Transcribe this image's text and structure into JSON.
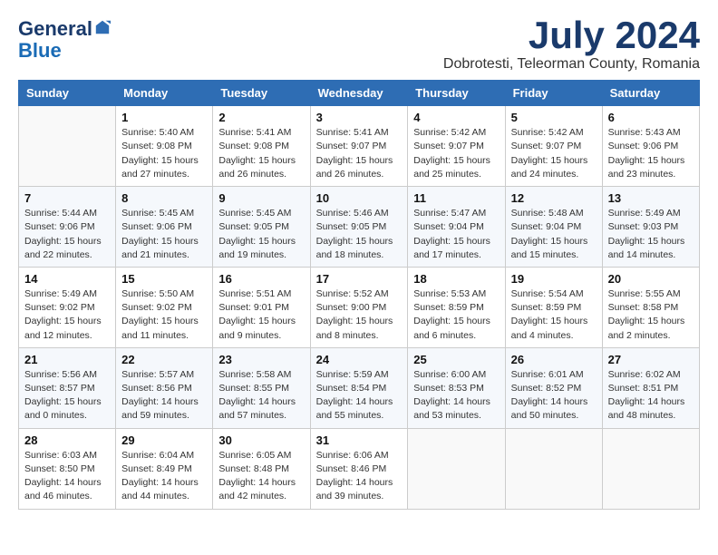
{
  "header": {
    "logo_general": "General",
    "logo_blue": "Blue",
    "main_title": "July 2024",
    "subtitle": "Dobrotesti, Teleorman County, Romania"
  },
  "calendar": {
    "days_of_week": [
      "Sunday",
      "Monday",
      "Tuesday",
      "Wednesday",
      "Thursday",
      "Friday",
      "Saturday"
    ],
    "weeks": [
      [
        {
          "day": "",
          "info": ""
        },
        {
          "day": "1",
          "info": "Sunrise: 5:40 AM\nSunset: 9:08 PM\nDaylight: 15 hours\nand 27 minutes."
        },
        {
          "day": "2",
          "info": "Sunrise: 5:41 AM\nSunset: 9:08 PM\nDaylight: 15 hours\nand 26 minutes."
        },
        {
          "day": "3",
          "info": "Sunrise: 5:41 AM\nSunset: 9:07 PM\nDaylight: 15 hours\nand 26 minutes."
        },
        {
          "day": "4",
          "info": "Sunrise: 5:42 AM\nSunset: 9:07 PM\nDaylight: 15 hours\nand 25 minutes."
        },
        {
          "day": "5",
          "info": "Sunrise: 5:42 AM\nSunset: 9:07 PM\nDaylight: 15 hours\nand 24 minutes."
        },
        {
          "day": "6",
          "info": "Sunrise: 5:43 AM\nSunset: 9:06 PM\nDaylight: 15 hours\nand 23 minutes."
        }
      ],
      [
        {
          "day": "7",
          "info": "Sunrise: 5:44 AM\nSunset: 9:06 PM\nDaylight: 15 hours\nand 22 minutes."
        },
        {
          "day": "8",
          "info": "Sunrise: 5:45 AM\nSunset: 9:06 PM\nDaylight: 15 hours\nand 21 minutes."
        },
        {
          "day": "9",
          "info": "Sunrise: 5:45 AM\nSunset: 9:05 PM\nDaylight: 15 hours\nand 19 minutes."
        },
        {
          "day": "10",
          "info": "Sunrise: 5:46 AM\nSunset: 9:05 PM\nDaylight: 15 hours\nand 18 minutes."
        },
        {
          "day": "11",
          "info": "Sunrise: 5:47 AM\nSunset: 9:04 PM\nDaylight: 15 hours\nand 17 minutes."
        },
        {
          "day": "12",
          "info": "Sunrise: 5:48 AM\nSunset: 9:04 PM\nDaylight: 15 hours\nand 15 minutes."
        },
        {
          "day": "13",
          "info": "Sunrise: 5:49 AM\nSunset: 9:03 PM\nDaylight: 15 hours\nand 14 minutes."
        }
      ],
      [
        {
          "day": "14",
          "info": "Sunrise: 5:49 AM\nSunset: 9:02 PM\nDaylight: 15 hours\nand 12 minutes."
        },
        {
          "day": "15",
          "info": "Sunrise: 5:50 AM\nSunset: 9:02 PM\nDaylight: 15 hours\nand 11 minutes."
        },
        {
          "day": "16",
          "info": "Sunrise: 5:51 AM\nSunset: 9:01 PM\nDaylight: 15 hours\nand 9 minutes."
        },
        {
          "day": "17",
          "info": "Sunrise: 5:52 AM\nSunset: 9:00 PM\nDaylight: 15 hours\nand 8 minutes."
        },
        {
          "day": "18",
          "info": "Sunrise: 5:53 AM\nSunset: 8:59 PM\nDaylight: 15 hours\nand 6 minutes."
        },
        {
          "day": "19",
          "info": "Sunrise: 5:54 AM\nSunset: 8:59 PM\nDaylight: 15 hours\nand 4 minutes."
        },
        {
          "day": "20",
          "info": "Sunrise: 5:55 AM\nSunset: 8:58 PM\nDaylight: 15 hours\nand 2 minutes."
        }
      ],
      [
        {
          "day": "21",
          "info": "Sunrise: 5:56 AM\nSunset: 8:57 PM\nDaylight: 15 hours\nand 0 minutes."
        },
        {
          "day": "22",
          "info": "Sunrise: 5:57 AM\nSunset: 8:56 PM\nDaylight: 14 hours\nand 59 minutes."
        },
        {
          "day": "23",
          "info": "Sunrise: 5:58 AM\nSunset: 8:55 PM\nDaylight: 14 hours\nand 57 minutes."
        },
        {
          "day": "24",
          "info": "Sunrise: 5:59 AM\nSunset: 8:54 PM\nDaylight: 14 hours\nand 55 minutes."
        },
        {
          "day": "25",
          "info": "Sunrise: 6:00 AM\nSunset: 8:53 PM\nDaylight: 14 hours\nand 53 minutes."
        },
        {
          "day": "26",
          "info": "Sunrise: 6:01 AM\nSunset: 8:52 PM\nDaylight: 14 hours\nand 50 minutes."
        },
        {
          "day": "27",
          "info": "Sunrise: 6:02 AM\nSunset: 8:51 PM\nDaylight: 14 hours\nand 48 minutes."
        }
      ],
      [
        {
          "day": "28",
          "info": "Sunrise: 6:03 AM\nSunset: 8:50 PM\nDaylight: 14 hours\nand 46 minutes."
        },
        {
          "day": "29",
          "info": "Sunrise: 6:04 AM\nSunset: 8:49 PM\nDaylight: 14 hours\nand 44 minutes."
        },
        {
          "day": "30",
          "info": "Sunrise: 6:05 AM\nSunset: 8:48 PM\nDaylight: 14 hours\nand 42 minutes."
        },
        {
          "day": "31",
          "info": "Sunrise: 6:06 AM\nSunset: 8:46 PM\nDaylight: 14 hours\nand 39 minutes."
        },
        {
          "day": "",
          "info": ""
        },
        {
          "day": "",
          "info": ""
        },
        {
          "day": "",
          "info": ""
        }
      ]
    ]
  }
}
